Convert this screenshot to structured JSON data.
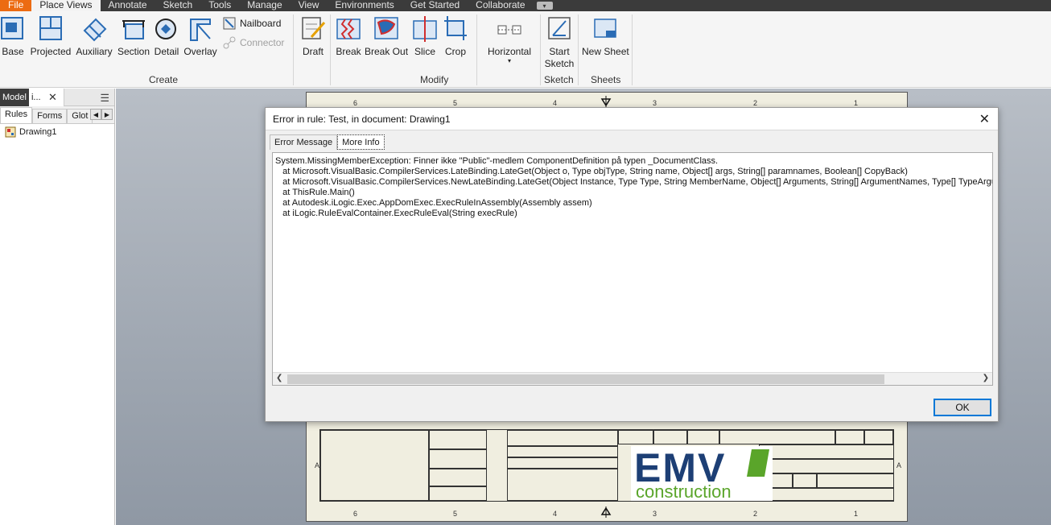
{
  "menu": {
    "file": "File",
    "tabs": [
      "Place Views",
      "Annotate",
      "Sketch",
      "Tools",
      "Manage",
      "View",
      "Environments",
      "Get Started",
      "Collaborate"
    ]
  },
  "ribbon": {
    "create": {
      "label": "Create",
      "base": "Base",
      "projected": "Projected",
      "auxiliary": "Auxiliary",
      "section": "Section",
      "detail": "Detail",
      "overlay": "Overlay",
      "nailboard": "Nailboard",
      "connector": "Connector",
      "draft": "Draft"
    },
    "modify": {
      "label": "Modify",
      "break": "Break",
      "break_out": "Break Out",
      "slice": "Slice",
      "crop": "Crop",
      "horizontal": "Horizontal"
    },
    "sketch": {
      "label": "Sketch",
      "start_sketch_1": "Start",
      "start_sketch_2": "Sketch"
    },
    "sheets": {
      "label": "Sheets",
      "new_sheet": "New Sheet"
    }
  },
  "panel": {
    "tab_model": "Model",
    "tab_ilogic": "i...",
    "subtabs": [
      "Rules",
      "Forms",
      "Glot"
    ],
    "tree_item": "Drawing1"
  },
  "sheet": {
    "ruler_top": [
      "6",
      "5",
      "4",
      "3",
      "2",
      "1"
    ],
    "ruler_bottom": [
      "6",
      "5",
      "4",
      "3",
      "2",
      "1"
    ],
    "zone_letters": [
      "A",
      "A"
    ],
    "logo_main": "EMV",
    "logo_sub": "construction"
  },
  "dialog": {
    "title": "Error in rule: Test, in document: Drawing1",
    "tab_error": "Error Message",
    "tab_more": "More Info",
    "lines": [
      "System.MissingMemberException: Finner ikke \"Public\"-medlem ComponentDefinition på typen _DocumentClass.",
      "   at Microsoft.VisualBasic.CompilerServices.LateBinding.LateGet(Object o, Type objType, String name, Object[] args, String[] paramnames, Boolean[] CopyBack)",
      "   at Microsoft.VisualBasic.CompilerServices.NewLateBinding.LateGet(Object Instance, Type Type, String MemberName, Object[] Arguments, String[] ArgumentNames, Type[] TypeArgum",
      "   at ThisRule.Main()",
      "   at Autodesk.iLogic.Exec.AppDomExec.ExecRuleInAssembly(Assembly assem)",
      "   at iLogic.RuleEvalContainer.ExecRuleEval(String execRule)"
    ],
    "ok": "OK"
  },
  "colors": {
    "file_tab": "#ec6b12",
    "menu_bg": "#3b3b3b",
    "logo_blue": "#1d3f75",
    "logo_green": "#5aa52a",
    "ok_border": "#0078d7"
  }
}
